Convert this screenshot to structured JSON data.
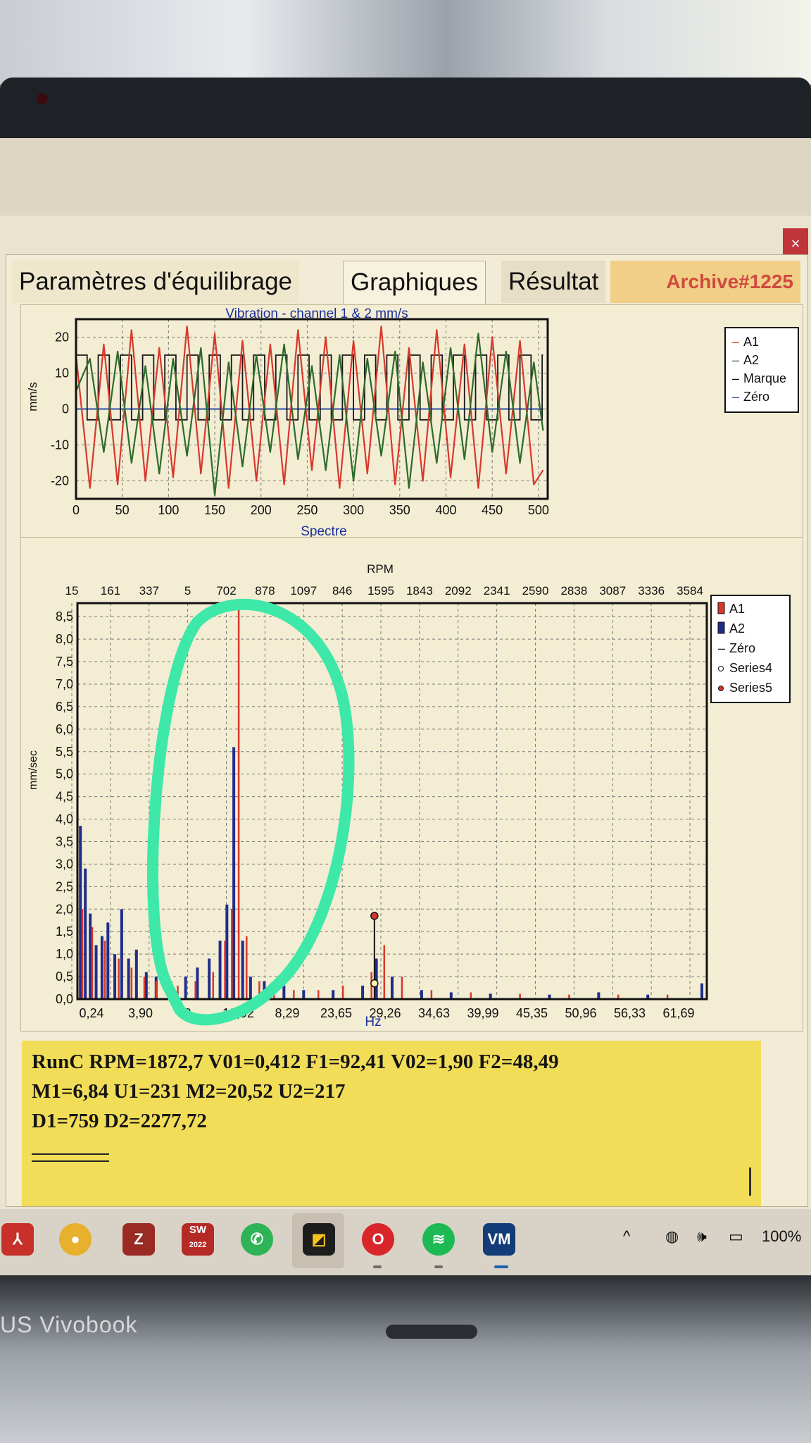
{
  "tabs": {
    "balancing": "Paramètres d'équilibrage",
    "graphs": "Graphiques",
    "result": "Résultat",
    "archive": "Archive#1225"
  },
  "close_glyph": "×",
  "vibration_chart": {
    "title": "Vibration  - channel 1 & 2 mm/s",
    "ylabel": "mm/s",
    "xlabel": "Spectre",
    "y_ticks": [
      "20",
      "10",
      "0",
      "-10",
      "-20"
    ],
    "x_ticks": [
      "0",
      "50",
      "100",
      "150",
      "200",
      "250",
      "300",
      "350",
      "400",
      "450",
      "500"
    ],
    "legend": [
      "A1",
      "A2",
      "Marque",
      "Zéro"
    ]
  },
  "spectrum_chart": {
    "top_axis_title": "RPM",
    "top_ticks": [
      "15",
      "161",
      "337",
      "5",
      "702",
      "878",
      "1097",
      "846",
      "1595",
      "1843",
      "2092",
      "2341",
      "2590",
      "2838",
      "3087",
      "3336",
      "3584"
    ],
    "ylabel": "mm/sec",
    "xlabel": "Hz",
    "y_ticks": [
      "8,5",
      "8,0",
      "7,5",
      "7,0",
      "6,5",
      "6,0",
      "5,5",
      "5,0",
      "4,5",
      "4,0",
      "3,5",
      "3,0",
      "2,5",
      "2,0",
      "1,5",
      "1,0",
      "0,5",
      "0,0"
    ],
    "x_ticks": [
      "0,24",
      "3,90",
      "8,",
      "12,92",
      "8,29",
      "23,65",
      "29,26",
      "34,63",
      "39,99",
      "45,35",
      "50,96",
      "56,33",
      "61,69"
    ],
    "legend": [
      "A1",
      "A2",
      "Zéro",
      "Series4",
      "Series5"
    ]
  },
  "chart_data": [
    {
      "type": "line",
      "title": "Vibration  - channel 1 & 2 mm/s",
      "xlabel": "Spectre",
      "ylabel": "mm/s",
      "xlim": [
        0,
        510
      ],
      "ylim": [
        -25,
        25
      ],
      "grid": true,
      "legend_position": "right",
      "series": [
        {
          "name": "A1",
          "color": "#d8382c",
          "x": [
            0,
            15,
            30,
            45,
            60,
            75,
            90,
            105,
            120,
            135,
            150,
            165,
            180,
            195,
            210,
            225,
            240,
            255,
            270,
            285,
            300,
            315,
            330,
            345,
            360,
            375,
            390,
            405,
            420,
            435,
            450,
            465,
            480,
            495,
            505
          ],
          "y": [
            15,
            -22,
            18,
            -21,
            22,
            -20,
            17,
            -19,
            23,
            -18,
            21,
            -22,
            19,
            -20,
            18,
            -21,
            22,
            -17,
            20,
            -22,
            19,
            -18,
            23,
            -21,
            17,
            -20,
            22,
            -19,
            18,
            -22,
            20,
            -18,
            19,
            -21,
            -17
          ]
        },
        {
          "name": "A2",
          "color": "#2c6b2a",
          "x": [
            0,
            15,
            30,
            45,
            60,
            75,
            90,
            105,
            120,
            135,
            150,
            165,
            180,
            195,
            210,
            225,
            240,
            255,
            270,
            285,
            300,
            315,
            330,
            345,
            360,
            375,
            390,
            405,
            420,
            435,
            450,
            465,
            480,
            495,
            505
          ],
          "y": [
            5,
            14,
            -12,
            16,
            -15,
            12,
            -18,
            14,
            -13,
            17,
            -24,
            13,
            -16,
            15,
            -12,
            18,
            -14,
            12,
            -17,
            15,
            -20,
            14,
            -13,
            16,
            -22,
            13,
            -15,
            17,
            -14,
            21,
            -12,
            16,
            -15,
            13,
            -6
          ]
        },
        {
          "name": "Marque",
          "color": "#1a1a1a",
          "note": "square wave",
          "y_high": 15,
          "y_low": -3
        },
        {
          "name": "Zéro",
          "color": "#2a4fa8",
          "x": [
            0,
            505
          ],
          "y": [
            0,
            0
          ]
        }
      ]
    },
    {
      "type": "bar",
      "xlabel": "Hz",
      "ylabel": "mm/sec",
      "secondary_axis": "RPM",
      "xlim": [
        0,
        64
      ],
      "ylim": [
        0,
        8.8
      ],
      "grid": true,
      "legend_position": "right",
      "series": [
        {
          "name": "A1",
          "color": "#d8382c",
          "x": [
            0.5,
            1.5,
            2.8,
            4.2,
            5.5,
            6.8,
            8.0,
            10.2,
            12.0,
            13.8,
            15.0,
            15.7,
            16.4,
            17.2,
            18.5,
            20.0,
            22.0,
            24.5,
            27.0,
            29.9,
            31.2,
            33.0,
            36.0,
            40.0,
            45.0,
            50.0,
            55.0,
            60.0
          ],
          "y": [
            2.0,
            1.6,
            1.3,
            0.9,
            0.7,
            0.5,
            0.4,
            0.3,
            0.4,
            0.6,
            1.3,
            2.0,
            8.7,
            1.4,
            0.4,
            0.3,
            0.2,
            0.2,
            0.3,
            0.6,
            1.2,
            0.5,
            0.2,
            0.15,
            0.12,
            0.1,
            0.1,
            0.1
          ]
        },
        {
          "name": "A2",
          "color": "#1f2d8a",
          "x": [
            0.3,
            0.8,
            1.3,
            1.9,
            2.5,
            3.1,
            3.8,
            4.5,
            5.2,
            6.0,
            7.0,
            8.0,
            9.5,
            11.0,
            12.2,
            13.4,
            14.5,
            15.2,
            15.9,
            16.8,
            17.6,
            19.0,
            21.0,
            23.0,
            26.0,
            29.0,
            30.4,
            32.0,
            35.0,
            38.0,
            42.0,
            48.0,
            53.0,
            58.0,
            63.5
          ],
          "y": [
            3.85,
            2.9,
            1.9,
            1.2,
            1.4,
            1.7,
            1.0,
            2.0,
            0.9,
            1.1,
            0.6,
            0.5,
            0.4,
            0.5,
            0.7,
            0.9,
            1.3,
            2.1,
            5.6,
            1.3,
            0.5,
            0.4,
            0.3,
            0.2,
            0.2,
            0.3,
            0.9,
            0.5,
            0.2,
            0.15,
            0.12,
            0.1,
            0.15,
            0.1,
            0.35
          ]
        },
        {
          "name": "Zéro",
          "color": "#1a1a1a",
          "x": [
            0,
            64
          ],
          "y": [
            0,
            0
          ]
        },
        {
          "name": "Series4",
          "x": [
            30.2
          ],
          "y": [
            0.35
          ]
        },
        {
          "name": "Series5",
          "x": [
            30.2
          ],
          "y": [
            1.85
          ]
        }
      ]
    }
  ],
  "output": {
    "line1": "RunC  RPM=1872,7 V01=0,412 F1=92,41 V02=1,90 F2=48,49",
    "line2": "M1=6,84 U1=231 M2=20,52 U2=217",
    "line3": "D1=759 D2=2277,72"
  },
  "taskbar": {
    "icons": [
      "pdf-icon",
      "chrome-icon",
      "zotero-icon",
      "solidworks-icon",
      "whatsapp-icon",
      "app-icon",
      "opera-icon",
      "spotify-icon",
      "balancer-icon"
    ],
    "sw_label": "SW",
    "sw_year": "2022",
    "z_label": "Z",
    "vm_label": "VM",
    "chevron": "^",
    "battery": "100%"
  },
  "laptop_brand": "US Vivobook",
  "colors": {
    "a1": "#d8382c",
    "a2_vibration": "#2c6b2a",
    "a2_spectrum": "#1f2d8a",
    "annotation": "#3ee8a8",
    "output_bg": "#f2dd58"
  }
}
